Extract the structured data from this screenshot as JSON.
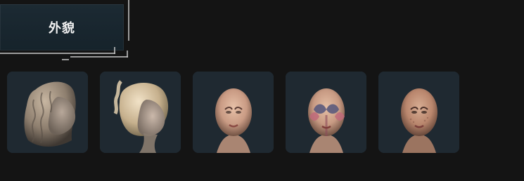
{
  "panel": {
    "title": "外貌"
  },
  "appearance_options": [
    {
      "icon": "wavy-hair-icon"
    },
    {
      "icon": "braided-hair-icon"
    },
    {
      "icon": "bald-face-icon"
    },
    {
      "icon": "face-paint-icon"
    },
    {
      "icon": "bald-face-2-icon"
    }
  ],
  "colors": {
    "background": "#141414",
    "card": "#1f2931",
    "title_panel": "#1c2a33",
    "title_text": "#f2f2f2",
    "frame": "#c9c9c9"
  }
}
